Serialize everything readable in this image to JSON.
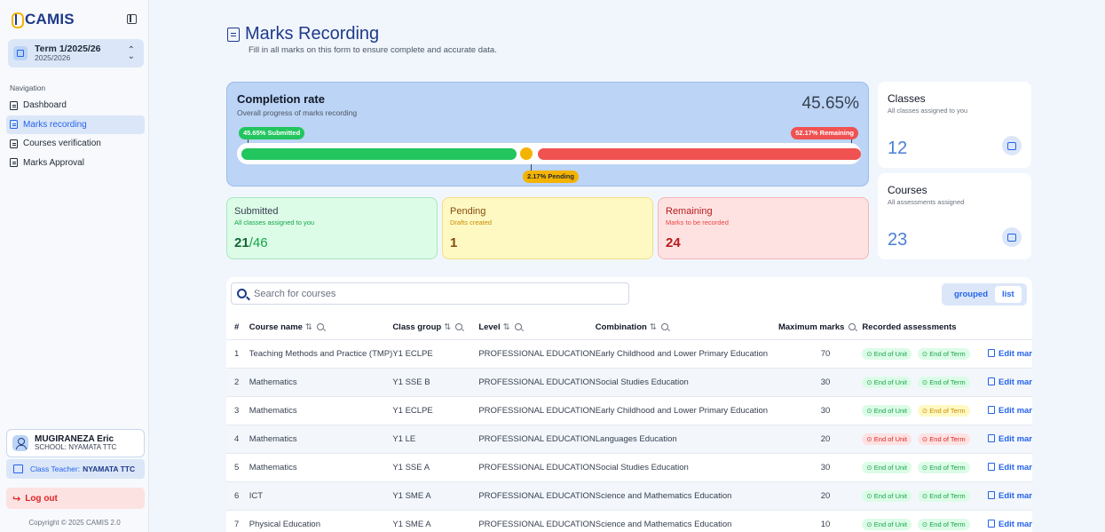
{
  "app": {
    "name": "CAMIS"
  },
  "term": {
    "title": "Term 1/2025/26",
    "year": "2025/2026"
  },
  "nav": {
    "label": "Navigation",
    "items": [
      {
        "label": "Dashboard",
        "active": false
      },
      {
        "label": "Marks recording",
        "active": true
      },
      {
        "label": "Courses verification",
        "active": false
      },
      {
        "label": "Marks Approval",
        "active": false
      }
    ]
  },
  "user": {
    "name": "MUGIRANEZA Eric",
    "school": "SCHOOL: NYAMATA TTC",
    "class_teacher_label": "Class Teacher:",
    "class_teacher_value": "NYAMATA TTC"
  },
  "logout_label": "Log out",
  "copyright": "Copyright © 2025 CAMIS 2.0",
  "page": {
    "title": "Marks Recording",
    "subtitle": "Fill in all marks on this form to ensure complete and accurate data."
  },
  "completion": {
    "title": "Completion rate",
    "subtitle": "Overall progress of marks recording",
    "percent": "45.65%",
    "submitted_pill": "45.65% Submitted",
    "remaining_pill": "52.17% Remaining",
    "pending_pill": "2.17% Pending",
    "submitted_fraction": 0.4565,
    "pending_fraction": 0.0217,
    "remaining_fraction": 0.5217
  },
  "stats": {
    "submitted": {
      "title": "Submitted",
      "subtitle": "All classes assigned to you",
      "value": "21",
      "total": "/46"
    },
    "pending": {
      "title": "Pending",
      "subtitle": "Drafts created",
      "value": "1"
    },
    "remaining": {
      "title": "Remaining",
      "subtitle": "Marks to be recorded",
      "value": "24"
    }
  },
  "cards": {
    "classes": {
      "title": "Classes",
      "subtitle": "All classes assigned to you",
      "value": "12",
      "icon": "presentation-icon"
    },
    "courses": {
      "title": "Courses",
      "subtitle": "All assessments assigned",
      "value": "23",
      "icon": "check-icon"
    }
  },
  "search": {
    "placeholder": "Search for courses"
  },
  "view_toggle": {
    "grouped": "grouped",
    "list": "list"
  },
  "table": {
    "headers": {
      "num": "#",
      "course": "Course name",
      "class": "Class group",
      "level": "Level",
      "combination": "Combination",
      "max": "Maximum marks",
      "recorded": "Recorded assessments"
    },
    "rows": [
      {
        "num": "1",
        "course": "Teaching Methods and Practice (TMP)",
        "class": "Y1 ECLPE",
        "level": "PROFESSIONAL EDUCATION",
        "combination": "Early Childhood and Lower Primary Education",
        "max": "70",
        "unit": "End of Unit",
        "unit_status": "green",
        "term": "End of Term",
        "term_status": "green",
        "action": "Edit mar"
      },
      {
        "num": "2",
        "course": "Mathematics",
        "class": "Y1 SSE B",
        "level": "PROFESSIONAL EDUCATION",
        "combination": "Social Studies Education",
        "max": "30",
        "unit": "End of Unit",
        "unit_status": "green",
        "term": "End of Term",
        "term_status": "green",
        "action": "Edit mar"
      },
      {
        "num": "3",
        "course": "Mathematics",
        "class": "Y1 ECLPE",
        "level": "PROFESSIONAL EDUCATION",
        "combination": "Early Childhood and Lower Primary Education",
        "max": "30",
        "unit": "End of Unit",
        "unit_status": "green",
        "term": "End of Term",
        "term_status": "yellow",
        "action": "Edit mar"
      },
      {
        "num": "4",
        "course": "Mathematics",
        "class": "Y1 LE",
        "level": "PROFESSIONAL EDUCATION",
        "combination": "Languages Education",
        "max": "20",
        "unit": "End of Unit",
        "unit_status": "red",
        "term": "End of Term",
        "term_status": "red",
        "action": "Edit mar"
      },
      {
        "num": "5",
        "course": "Mathematics",
        "class": "Y1 SSE A",
        "level": "PROFESSIONAL EDUCATION",
        "combination": "Social Studies Education",
        "max": "30",
        "unit": "End of Unit",
        "unit_status": "green",
        "term": "End of Term",
        "term_status": "green",
        "action": "Edit mar"
      },
      {
        "num": "6",
        "course": "ICT",
        "class": "Y1 SME A",
        "level": "PROFESSIONAL EDUCATION",
        "combination": "Science and Mathematics Education",
        "max": "20",
        "unit": "End of Unit",
        "unit_status": "green",
        "term": "End of Term",
        "term_status": "green",
        "action": "Edit mar"
      },
      {
        "num": "7",
        "course": "Physical Education",
        "class": "Y1 SME A",
        "level": "PROFESSIONAL EDUCATION",
        "combination": "Science and Mathematics Education",
        "max": "10",
        "unit": "End of Unit",
        "unit_status": "green",
        "term": "End of Term",
        "term_status": "green",
        "action": "Edit mar"
      }
    ]
  },
  "colors": {
    "primary": "#2563eb",
    "brand": "#1e3a8a",
    "submitted": "#22c55e",
    "pending": "#f5b301",
    "remaining": "#f05252"
  }
}
